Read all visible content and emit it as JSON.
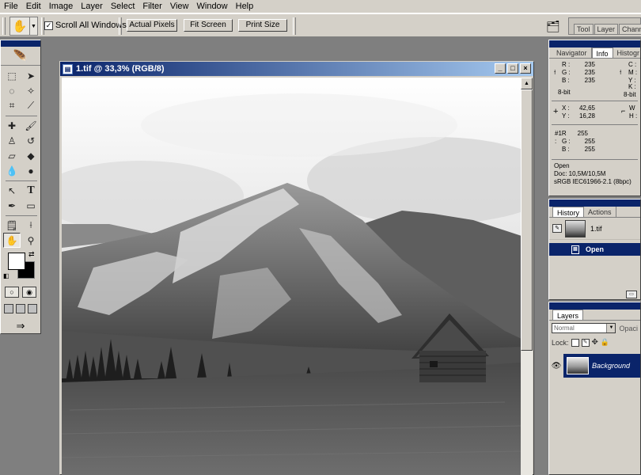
{
  "menubar": {
    "items": [
      "File",
      "Edit",
      "Image",
      "Layer",
      "Select",
      "Filter",
      "View",
      "Window",
      "Help"
    ]
  },
  "options_bar": {
    "scroll_all_label": "Scroll All Windows",
    "scroll_all_checked": true,
    "actual_pixels": "Actual Pixels",
    "fit_screen": "Fit Screen",
    "print_size": "Print Size",
    "well_tabs": [
      "Tool",
      "Layer",
      "Channe"
    ]
  },
  "document": {
    "title": "1.tif @ 33,3% (RGB/8)"
  },
  "info_panel": {
    "tabs": [
      "Navigator",
      "Info",
      "Histogr"
    ],
    "active_tab": "Info",
    "rgb": {
      "r_label": "R :",
      "g_label": "G :",
      "b_label": "B :",
      "r": "235",
      "g": "235",
      "b": "235",
      "bit": "8-bit"
    },
    "cmyk": {
      "c_label": "C :",
      "m_label": "M :",
      "y_label": "Y :",
      "k_label": "K :",
      "bit": "8-bit"
    },
    "coords": {
      "x_label": "X :",
      "y_label": "Y :",
      "x": "42,65",
      "y": "16,28",
      "w_label": "W :",
      "h_label": "H :"
    },
    "sampler": {
      "r_label": "#1R :",
      "g_label": "G :",
      "b_label": "B :",
      "r": "255",
      "g": "255",
      "b": "255"
    },
    "status": [
      "Open",
      "Doc: 10,5M/10,5M",
      "sRGB IEC61966-2.1 (8bpc)"
    ]
  },
  "history_panel": {
    "tabs": [
      "History",
      "Actions"
    ],
    "active_tab": "History",
    "snapshot_label": "1.tif",
    "state_label": "Open"
  },
  "layers_panel": {
    "tab": "Layers",
    "blend_mode": "Normal",
    "opacity_label": "Opaci",
    "lock_label": "Lock:",
    "layer_name": "Background"
  },
  "icons": {
    "hand": "✋",
    "zoom": "🔍",
    "text": "T"
  }
}
